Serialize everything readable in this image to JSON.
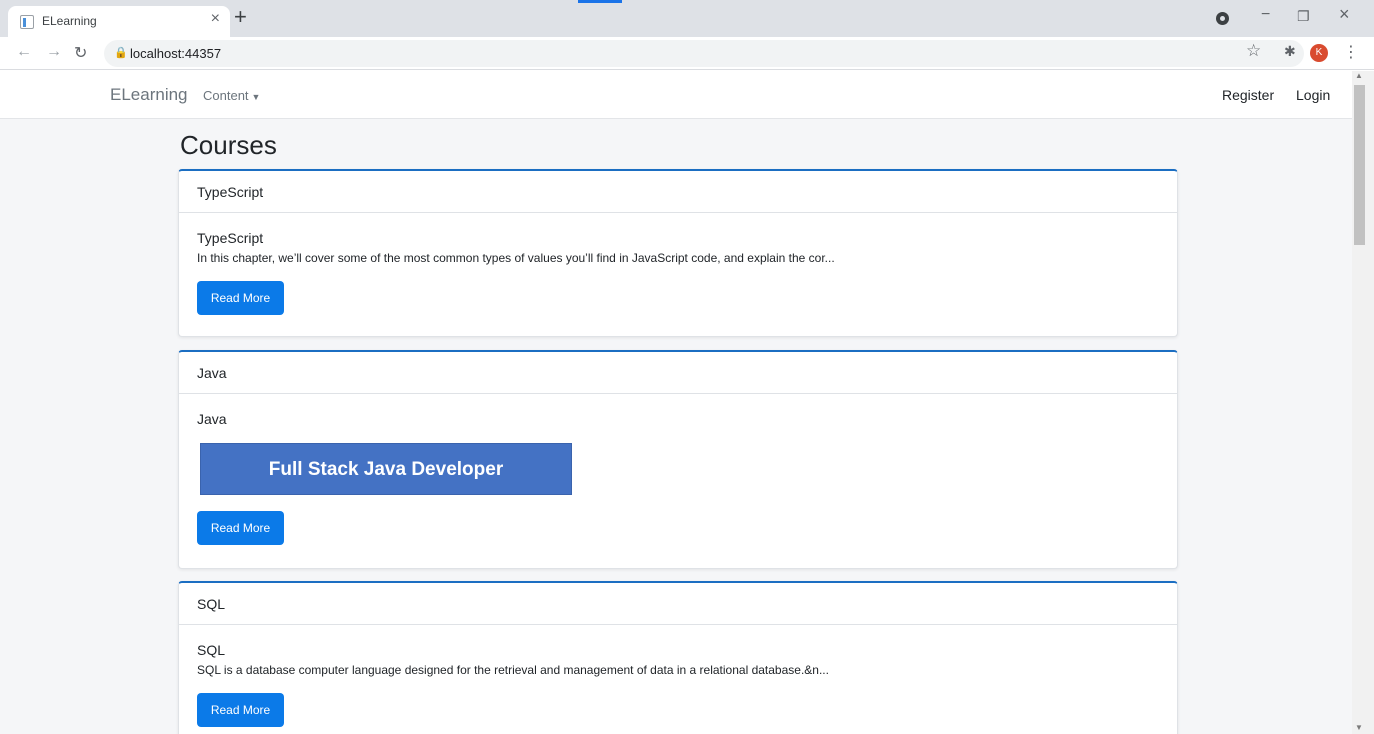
{
  "browser": {
    "tab_title": "ELearning",
    "tab_close": "×",
    "new_tab": "+",
    "url": "localhost:44357",
    "profile_initial": "K",
    "window_controls": {
      "minimize": "−",
      "restore": "❐",
      "close": "×"
    }
  },
  "navbar": {
    "brand": "ELearning",
    "content_menu": "Content",
    "register": "Register",
    "login": "Login"
  },
  "page": {
    "heading": "Courses",
    "courses": [
      {
        "header": "TypeScript",
        "title": "TypeScript",
        "description": "In this chapter, we’ll cover some of the most common types of values you’ll find in JavaScript code, and explain the cor...",
        "button": "Read More"
      },
      {
        "header": "Java",
        "title": "Java",
        "image_text": "Full Stack Java Developer",
        "button": "Read More"
      },
      {
        "header": "SQL",
        "title": "SQL",
        "description": "SQL is a database computer language designed for the retrieval and management of data in a relational database.&n...",
        "button": "Read More"
      }
    ]
  }
}
